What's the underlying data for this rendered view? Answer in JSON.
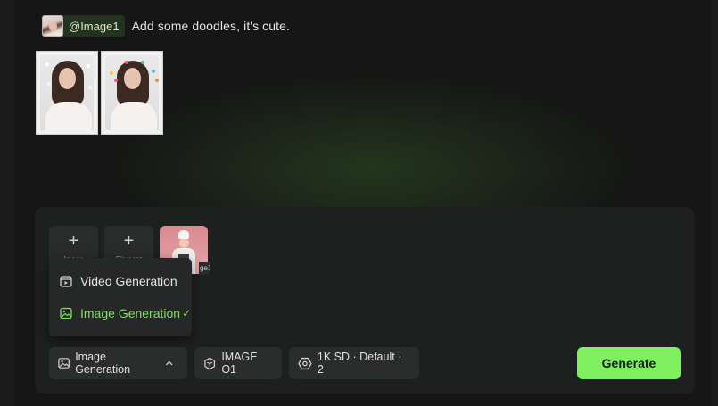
{
  "prompt": {
    "chip_label": "@Image1",
    "text": "Add some doodles, it's cute."
  },
  "composer": {
    "add_image_label": "Image",
    "add_element_label": "Element",
    "ref_tag": "ge1",
    "menu": {
      "items": [
        {
          "label": "Video Generation",
          "icon": "video-icon",
          "active": false
        },
        {
          "label": "Image Generation",
          "icon": "image-icon",
          "active": true
        }
      ]
    },
    "mode_pill": {
      "label": "Image Generation",
      "icon": "image-icon"
    },
    "model_pill": {
      "label": "IMAGE O1",
      "icon": "hexagon-icon"
    },
    "settings_pill": {
      "label": "1K SD · Default · 2",
      "icon": "settings-hex-icon"
    },
    "generate_label": "Generate"
  },
  "colors": {
    "accent": "#7ef05f",
    "active_text": "#7be25b",
    "background": "#151615",
    "panel": "#1e1f1f"
  }
}
